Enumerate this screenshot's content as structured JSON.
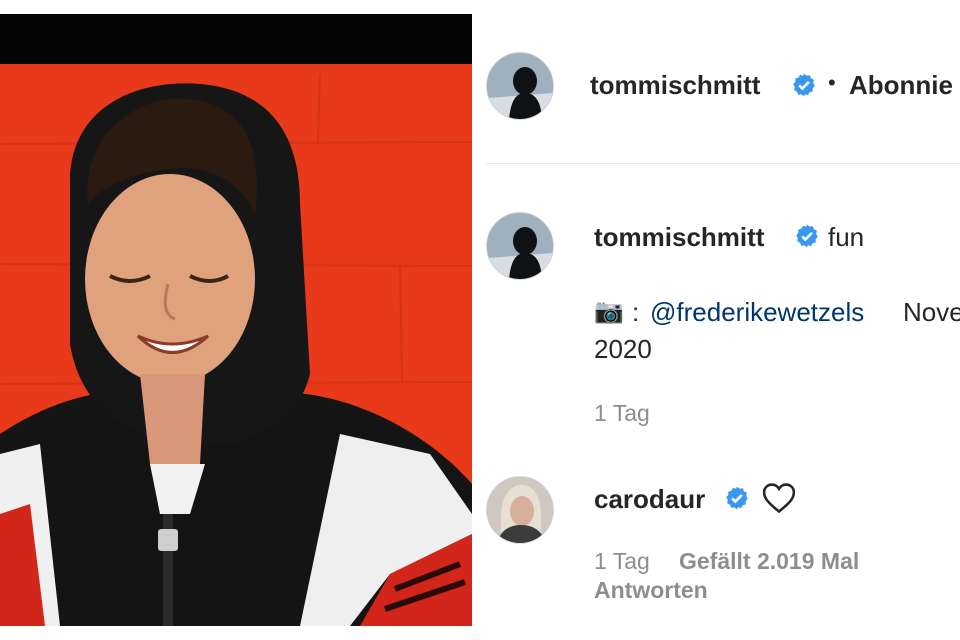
{
  "header": {
    "username": "tommischmitt",
    "separator": "•",
    "follow_label": "Abonnie"
  },
  "caption": {
    "username": "tommischmitt",
    "text": "fun",
    "camera_emoji": "📷",
    "colon": ":",
    "mention": "@frederikewetzels",
    "date_tail": "Nove",
    "date_year": "2020",
    "time_ago": "1 Tag"
  },
  "comment": {
    "username": "carodaur",
    "time_ago": "1 Tag",
    "likes": "Gefällt 2.019 Mal",
    "reply_label": "Antworten"
  },
  "colors": {
    "verified_blue": "#3897f0",
    "photo_background": "#e8391b",
    "meta_gray": "#8e8e8e",
    "mention_blue": "#00376b"
  },
  "icons": {
    "verified": "verified-badge-icon",
    "like": "heart-outline-icon"
  }
}
